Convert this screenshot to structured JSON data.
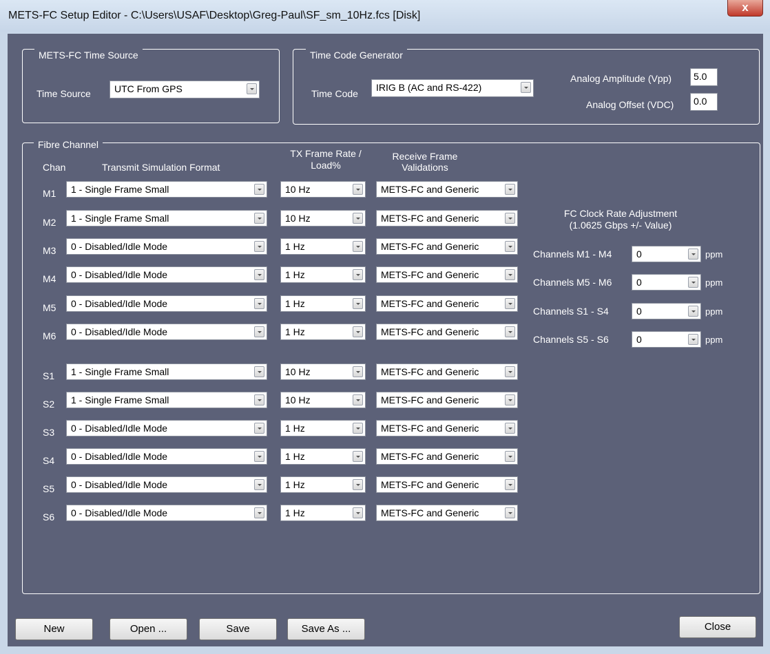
{
  "window": {
    "title": "METS-FC Setup Editor - C:\\Users\\USAF\\Desktop\\Greg-Paul\\SF_sm_10Hz.fcs [Disk]",
    "close_glyph": "x"
  },
  "time_source": {
    "group_title": "METS-FC Time Source",
    "label": "Time Source",
    "value": "UTC From GPS"
  },
  "time_code": {
    "group_title": "Time Code Generator",
    "label": "Time Code",
    "value": "IRIG B  (AC and RS-422)",
    "amplitude_label": "Analog Amplitude (Vpp)",
    "amplitude_value": "5.0",
    "offset_label": "Analog Offset (VDC)",
    "offset_value": "0.0"
  },
  "fibre": {
    "group_title": "Fibre Channel",
    "headers": {
      "chan": "Chan",
      "format": "Transmit Simulation Format",
      "rate_line1": "TX Frame Rate /",
      "rate_line2": "Load%",
      "valid_line1": "Receive Frame",
      "valid_line2": "Validations"
    },
    "channels": [
      {
        "name": "M1",
        "format": "1 - Single Frame Small",
        "rate": "10 Hz",
        "validation": "METS-FC and Generic"
      },
      {
        "name": "M2",
        "format": "1 - Single Frame Small",
        "rate": "10 Hz",
        "validation": "METS-FC and Generic"
      },
      {
        "name": "M3",
        "format": "0 - Disabled/Idle Mode",
        "rate": "1 Hz",
        "validation": "METS-FC and Generic"
      },
      {
        "name": "M4",
        "format": "0 - Disabled/Idle Mode",
        "rate": "1 Hz",
        "validation": "METS-FC and Generic"
      },
      {
        "name": "M5",
        "format": "0 - Disabled/Idle Mode",
        "rate": "1 Hz",
        "validation": "METS-FC and Generic"
      },
      {
        "name": "M6",
        "format": "0 - Disabled/Idle Mode",
        "rate": "1 Hz",
        "validation": "METS-FC and Generic"
      },
      {
        "name": "S1",
        "format": "1 - Single Frame Small",
        "rate": "10 Hz",
        "validation": "METS-FC and Generic"
      },
      {
        "name": "S2",
        "format": "1 - Single Frame Small",
        "rate": "10 Hz",
        "validation": "METS-FC and Generic"
      },
      {
        "name": "S3",
        "format": "0 - Disabled/Idle Mode",
        "rate": "1 Hz",
        "validation": "METS-FC and Generic"
      },
      {
        "name": "S4",
        "format": "0 - Disabled/Idle Mode",
        "rate": "1 Hz",
        "validation": "METS-FC and Generic"
      },
      {
        "name": "S5",
        "format": "0 - Disabled/Idle Mode",
        "rate": "1 Hz",
        "validation": "METS-FC and Generic"
      },
      {
        "name": "S6",
        "format": "0 - Disabled/Idle Mode",
        "rate": "1 Hz",
        "validation": "METS-FC and Generic"
      }
    ]
  },
  "clock": {
    "title_line1": "FC Clock Rate Adjustment",
    "title_line2": "(1.0625 Gbps +/- Value)",
    "rows": [
      {
        "label": "Channels M1 - M4",
        "value": "0",
        "unit": "ppm"
      },
      {
        "label": "Channels M5 - M6",
        "value": "0",
        "unit": "ppm"
      },
      {
        "label": "Channels S1 - S4",
        "value": "0",
        "unit": "ppm"
      },
      {
        "label": "Channels S5 - S6",
        "value": "0",
        "unit": "ppm"
      }
    ]
  },
  "buttons": {
    "new": "New",
    "open": "Open ...",
    "save": "Save",
    "save_as": "Save As ...",
    "close": "Close"
  }
}
